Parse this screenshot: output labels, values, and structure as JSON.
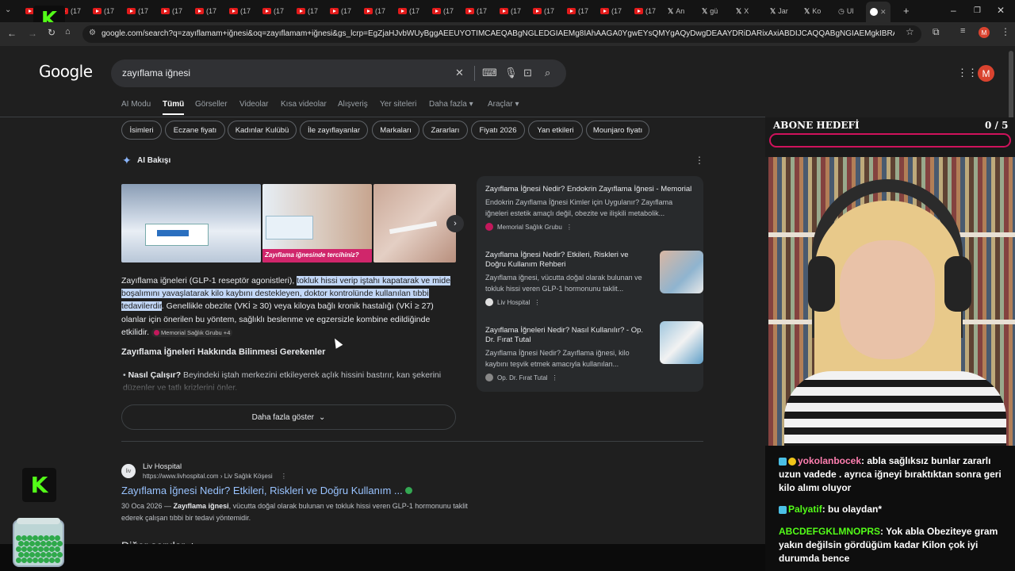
{
  "browser": {
    "tabs_repeat_label": "(17",
    "x_tabs": [
      {
        "label": "An"
      },
      {
        "label": "gü"
      },
      {
        "label": "X"
      },
      {
        "label": "Jar"
      },
      {
        "label": "Ko"
      }
    ],
    "active_tab_label": "Ul",
    "new_tab_icon": "plus-icon",
    "url": "google.com/search?q=zayıflamam+iğnesi&oq=zayıflamam+iğnesi&gs_lcrp=EgZjaHJvbWUyBggAEEUYOTIMCAEQABgNGLEDGIAEMg8IAhAAGA0YgwEYsQMYgAQyDwgDEAAYDRiDARixAxiABDIJCAQQABgNGIAEMgkIBRAAGA0YgAQyCQgGEAAY..."
  },
  "google": {
    "logo": "Google",
    "query": "zayıflama iğnesi",
    "avatar_letter": "M",
    "tabs": [
      "AI Modu",
      "Tümü",
      "Görseller",
      "Videolar",
      "Kısa videolar",
      "Alışveriş",
      "Yer siteleri",
      "Daha fazla",
      "Araçlar"
    ],
    "active_tab": "Tümü",
    "chips": [
      "İsimleri",
      "Eczane fiyatı",
      "Kadınlar Kulübü",
      "İle zayıflayanlar",
      "Markaları",
      "Zararları",
      "Fiyatı 2026",
      "Yan etkileri",
      "Mounjaro fiyatı"
    ],
    "ai_overview": {
      "title": "AI Bakışı",
      "image_caption": "Zayıflama iğnesinde tercihiniz?",
      "text_before": "Zayıflama iğneleri (GLP-1 reseptör agonistleri), ",
      "text_highlight": "tokluk hissi verip iştahı kapatarak ve mide boşalımını yavaşlatarak kilo kaybını destekleyen, doktor kontrolünde kullanılan tıbbi tedavilerdir",
      "text_after": ". Genellikle obezite (VKİ ≥ 30) veya kiloya bağlı kronik hastalığı (VKİ ≥ 27) olanlar için önerilen bu yöntem, sağlıklı beslenme ve egzersizle kombine edildiğinde etkilidir.",
      "source_chip": "Memorial Sağlık Grubu +4",
      "subheading": "Zayıflama İğneleri Hakkında Bilinmesi Gerekenler",
      "bullet_bold": "Nasıl Çalışır?",
      "bullet_text": " Beyindeki iştah merkezini etkileyerek açlık hissini bastırır, kan şekerini düzenler ve tatlı krizlerini önler.",
      "show_more": "Daha fazla göster"
    },
    "sources": [
      {
        "title": "Zayıflama İğnesi Nedir? Endokrin Zayıflama İğnesi - Memorial",
        "snippet": "Endokrin Zayıflama İğnesi Kimler için Uygulanır? Zayıflama iğneleri estetik amaçlı değil, obezite ve ilişkili metabolik...",
        "site": "Memorial Sağlık Grubu"
      },
      {
        "title": "Zayıflama İğnesi Nedir? Etkileri, Riskleri ve Doğru Kullanım Rehberi",
        "snippet": "Zayıflama iğnesi, vücutta doğal olarak bulunan ve tokluk hissi veren GLP-1 hormonunu taklit...",
        "site": "Liv Hospital"
      },
      {
        "title": "Zayıflama İğneleri Nedir? Nasıl Kullanılır? - Op. Dr. Fırat Tutal",
        "snippet": "Zayıflama İğnesi Nedir? Zayıflama iğnesi, kilo kaybını teşvik etmek amacıyla kullanılan...",
        "site": "Op. Dr. Fırat Tutal"
      }
    ],
    "result": {
      "site_name": "Liv Hospital",
      "favicon_text": "liv",
      "breadcrumb": "https://www.livhospital.com › Liv Sağlık Köşesi",
      "title": "Zayıflama İğnesi Nedir? Etkileri, Riskleri ve Doğru Kullanım ...",
      "date": "30 Oca 2026 — ",
      "snippet_bold": "Zayıflama iğnesi",
      "snippet": ", vücutta doğal olarak bulunan ve tokluk hissi veren GLP-1 hormonunu taklit ederek çalışan tıbbi bir tedavi yöntemidir."
    },
    "next_section": "Diğer sorular"
  },
  "overlay": {
    "kick_letter": "K",
    "goal_label": "ABONE HEDEFİ",
    "goal_count": "0 / 5",
    "goal_progress": 0,
    "chat": [
      {
        "user": "yokolanbocek",
        "user_color": "#ff7fb0",
        "text": ": abla sağlıksız bunlar zararlı uzun vadede . ayrıca iğneyi bıraktıktan sonra geri kilo alımı oluyor"
      },
      {
        "user": "Palyatif",
        "user_color": "#53fc18",
        "text": ": bu olaydan*"
      },
      {
        "user": "ABCDEFGKLMNOPRS",
        "user_color": "#53fc18",
        "text": ": Yok abla Obeziteye gram yakın değilsin gördüğüm kadar Kilon çok iyi durumda bence"
      }
    ]
  }
}
